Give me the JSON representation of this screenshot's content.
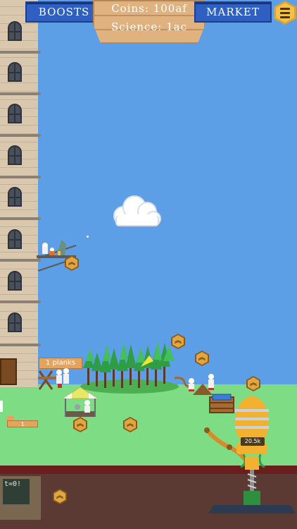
{
  "topbar": {
    "boosts_label": "BOOSTS",
    "market_label": "MARKET",
    "coins_label": "Coins:",
    "coins_value": "100af",
    "science_label": "Science:",
    "science_value": "1ac"
  },
  "icons": {
    "menu": "menu-icon",
    "coin_hex": "upgrade-hex-icon",
    "cloud": "cloud-icon"
  },
  "world": {
    "planks_label": "1 planks",
    "storage_label": "1",
    "balloon_label": "20.5k",
    "blackboard_text": "t=0!"
  },
  "colors": {
    "sky": "#5c9fe7",
    "grass": "#7edc85",
    "button_blue": "#2f5fc0",
    "sign_wood": "#e0b27f",
    "coin_gold": "#e1a640"
  }
}
